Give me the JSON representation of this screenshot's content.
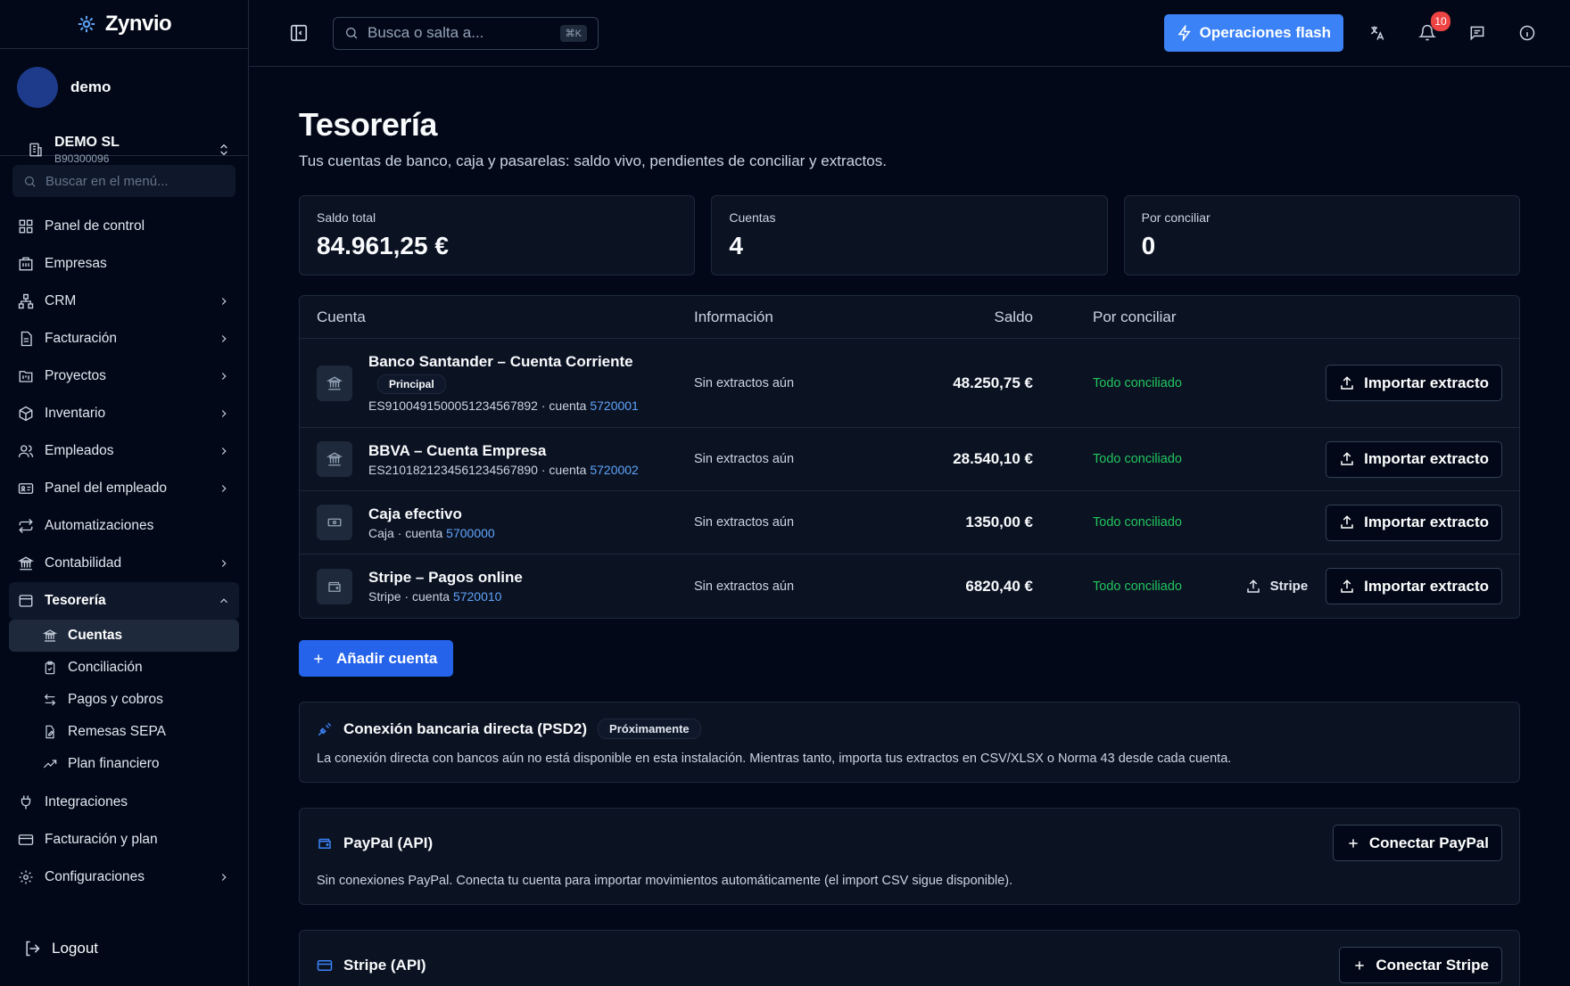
{
  "brand": {
    "name": "Zynvio"
  },
  "user": {
    "name": "demo"
  },
  "company": {
    "name": "DEMO SL",
    "cif": "B90300096"
  },
  "menu_search": {
    "placeholder": "Buscar en el menú..."
  },
  "nav": {
    "dashboard": "Panel de control",
    "empresas": "Empresas",
    "crm": "CRM",
    "facturacion": "Facturación",
    "proyectos": "Proyectos",
    "inventario": "Inventario",
    "empleados": "Empleados",
    "panel_empleado": "Panel del empleado",
    "automatizaciones": "Automatizaciones",
    "contabilidad": "Contabilidad",
    "tesoreria": "Tesorería",
    "tesoreria_sub": {
      "cuentas": "Cuentas",
      "conciliacion": "Conciliación",
      "pagos": "Pagos y cobros",
      "remesas": "Remesas SEPA",
      "plan": "Plan financiero"
    },
    "integraciones": "Integraciones",
    "facturacion_plan": "Facturación y plan",
    "configuraciones": "Configuraciones",
    "logout": "Logout"
  },
  "topbar": {
    "search_placeholder": "Busca o salta a...",
    "search_kbd": "⌘K",
    "flash_label": "Operaciones flash",
    "notifications_count": "10"
  },
  "page": {
    "title": "Tesorería",
    "subtitle": "Tus cuentas de banco, caja y pasarelas: saldo vivo, pendientes de conciliar y extractos."
  },
  "stats": [
    {
      "label": "Saldo total",
      "value": "84.961,25 €"
    },
    {
      "label": "Cuentas",
      "value": "4"
    },
    {
      "label": "Por conciliar",
      "value": "0"
    }
  ],
  "table": {
    "headers": {
      "cuenta": "Cuenta",
      "info": "Información",
      "saldo": "Saldo",
      "por_conciliar": "Por conciliar"
    },
    "import_label": "Importar extracto",
    "rows": [
      {
        "name": "Banco Santander – Cuenta Corriente",
        "tag": "Principal",
        "meta_prefix": "ES9100491500051234567892 · cuenta ",
        "account": "5720001",
        "info": "Sin extractos aún",
        "saldo": "48.250,75 €",
        "status": "Todo conciliado"
      },
      {
        "name": "BBVA – Cuenta Empresa",
        "meta_prefix": "ES2101821234561234567890 · cuenta ",
        "account": "5720002",
        "info": "Sin extractos aún",
        "saldo": "28.540,10 €",
        "status": "Todo conciliado"
      },
      {
        "name": "Caja efectivo",
        "meta_prefix": "Caja · cuenta ",
        "account": "5700000",
        "info": "Sin extractos aún",
        "saldo": "1350,00 €",
        "status": "Todo conciliado"
      },
      {
        "name": "Stripe – Pagos online",
        "meta_prefix": "Stripe · cuenta ",
        "account": "5720010",
        "info": "Sin extractos aún",
        "saldo": "6820,40 €",
        "status": "Todo conciliado",
        "extra_action": "Stripe"
      }
    ]
  },
  "add_account_label": "Añadir cuenta",
  "psd2": {
    "title": "Conexión bancaria directa (PSD2)",
    "badge": "Próximamente",
    "text": "La conexión directa con bancos aún no está disponible en esta instalación. Mientras tanto, importa tus extractos en CSV/XLSX o Norma 43 desde cada cuenta."
  },
  "paypal": {
    "title": "PayPal (API)",
    "button": "Conectar PayPal",
    "text": "Sin conexiones PayPal. Conecta tu cuenta para importar movimientos automáticamente (el import CSV sigue disponible)."
  },
  "stripe": {
    "title": "Stripe (API)",
    "button": "Conectar Stripe"
  },
  "colors": {
    "accent": "#3b82f6",
    "success": "#22c55e",
    "link": "#60a5fa",
    "danger": "#ef4444"
  }
}
